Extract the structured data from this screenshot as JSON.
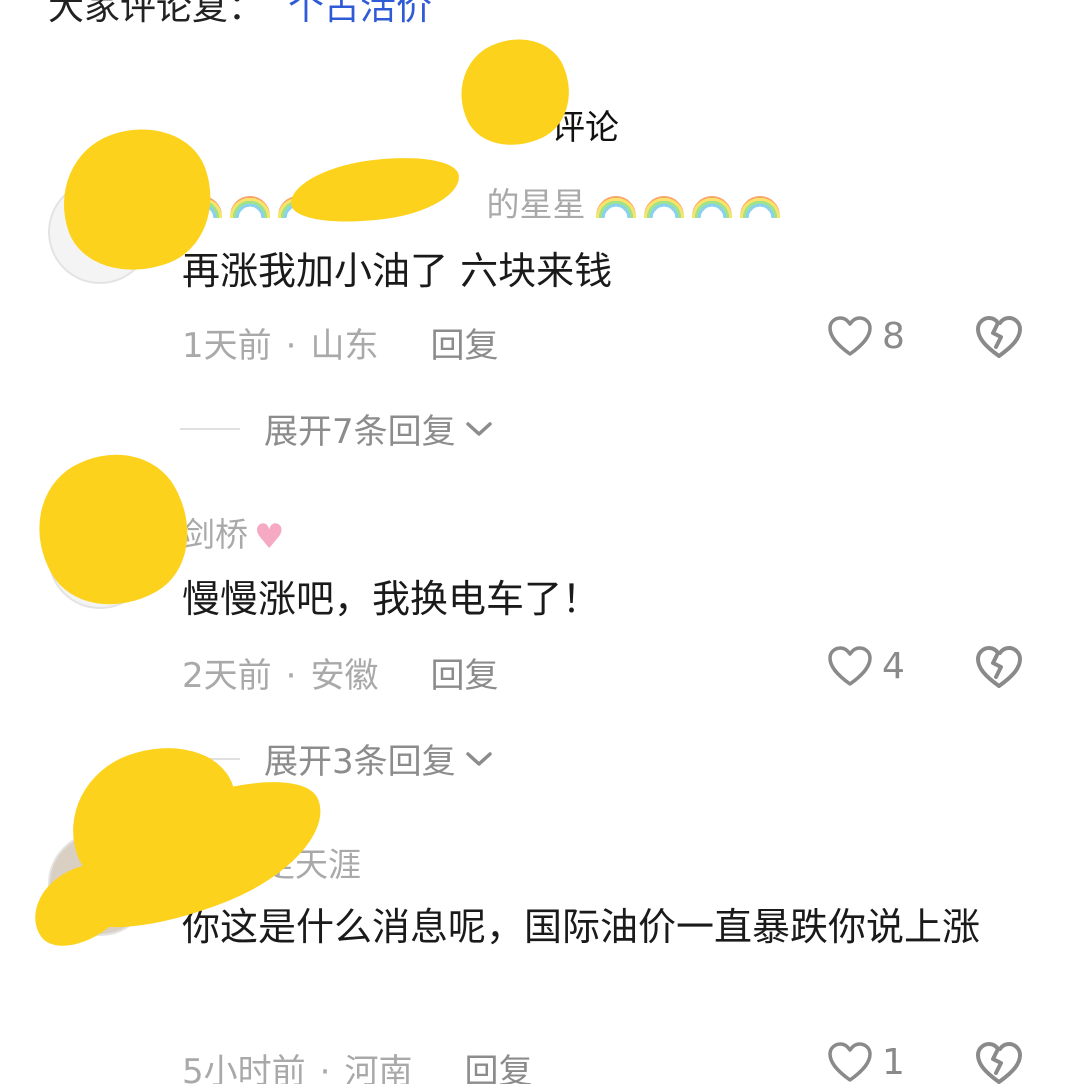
{
  "header": {
    "top_text_fragment": "大家评论复：",
    "top_link_fragment": "个占活价",
    "section_title": "评论"
  },
  "comments": [
    {
      "username_suffix": "的星星",
      "text": "再涨我加小油了 六块来钱",
      "time": "1天前",
      "location": "山东",
      "reply_label": "回复",
      "likes": "8",
      "expand_label": "展开7条回复"
    },
    {
      "username_suffix": "剑桥",
      "text": "慢慢涨吧，我换电车了！",
      "time": "2天前",
      "location": "安徽",
      "reply_label": "回复",
      "likes": "4",
      "expand_label": "展开3条回复"
    },
    {
      "username_suffix": "走天涯",
      "text": "你这是什么消息呢，国际油价一直暴跌你说上涨",
      "time": "5小时前",
      "location": "河南",
      "reply_label": "回复",
      "likes": "1"
    }
  ],
  "colors": {
    "censor_yellow": "#fcd21c",
    "meta_gray": "#a9a9a9",
    "body_text": "#1a1a1a"
  },
  "icons": {
    "like": "heart-outline-icon",
    "dislike": "broken-heart-icon",
    "expand": "chevron-down-icon"
  }
}
